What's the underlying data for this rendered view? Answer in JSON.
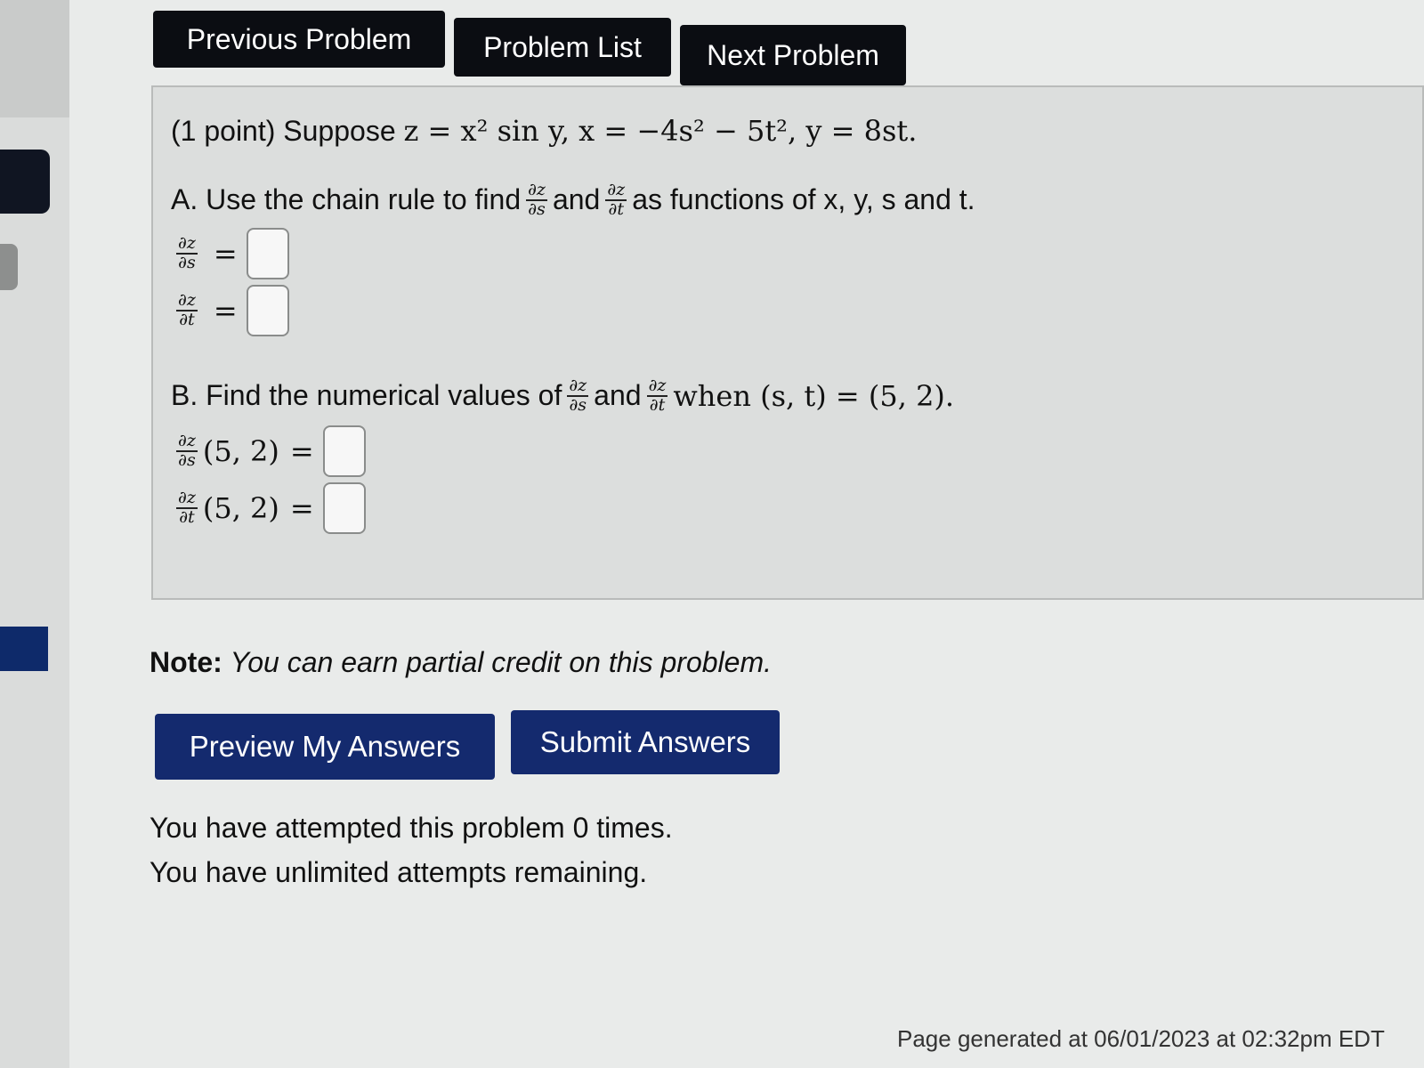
{
  "nav": {
    "previous": "Previous Problem",
    "list": "Problem List",
    "next": "Next Problem"
  },
  "problem": {
    "points": "(1 point) Suppose",
    "given": "z = x² sin y, x = −4s² − 5t², y = 8st.",
    "partA": {
      "prefix": "A. Use the chain rule to find",
      "and": "and",
      "suffix": "as functions of x, y, s and t.",
      "row1_num": "∂z",
      "row1_den": "∂s",
      "row2_num": "∂z",
      "row2_den": "∂t",
      "equals": "=",
      "answer1": "",
      "answer2": ""
    },
    "partB": {
      "prefix": "B. Find the numerical values of",
      "and": "and",
      "suffix": "when (s, t) = (5, 2).",
      "point": "(5, 2)",
      "equals": "=",
      "answer1": "",
      "answer2": ""
    }
  },
  "note": {
    "label": "Note:",
    "text": "You can earn partial credit on this problem."
  },
  "buttons": {
    "preview": "Preview My Answers",
    "submit": "Submit Answers"
  },
  "attempts": {
    "line1": "You have attempted this problem 0 times.",
    "line2": "You have unlimited attempts remaining."
  },
  "footer": "Page generated at 06/01/2023 at 02:32pm EDT"
}
